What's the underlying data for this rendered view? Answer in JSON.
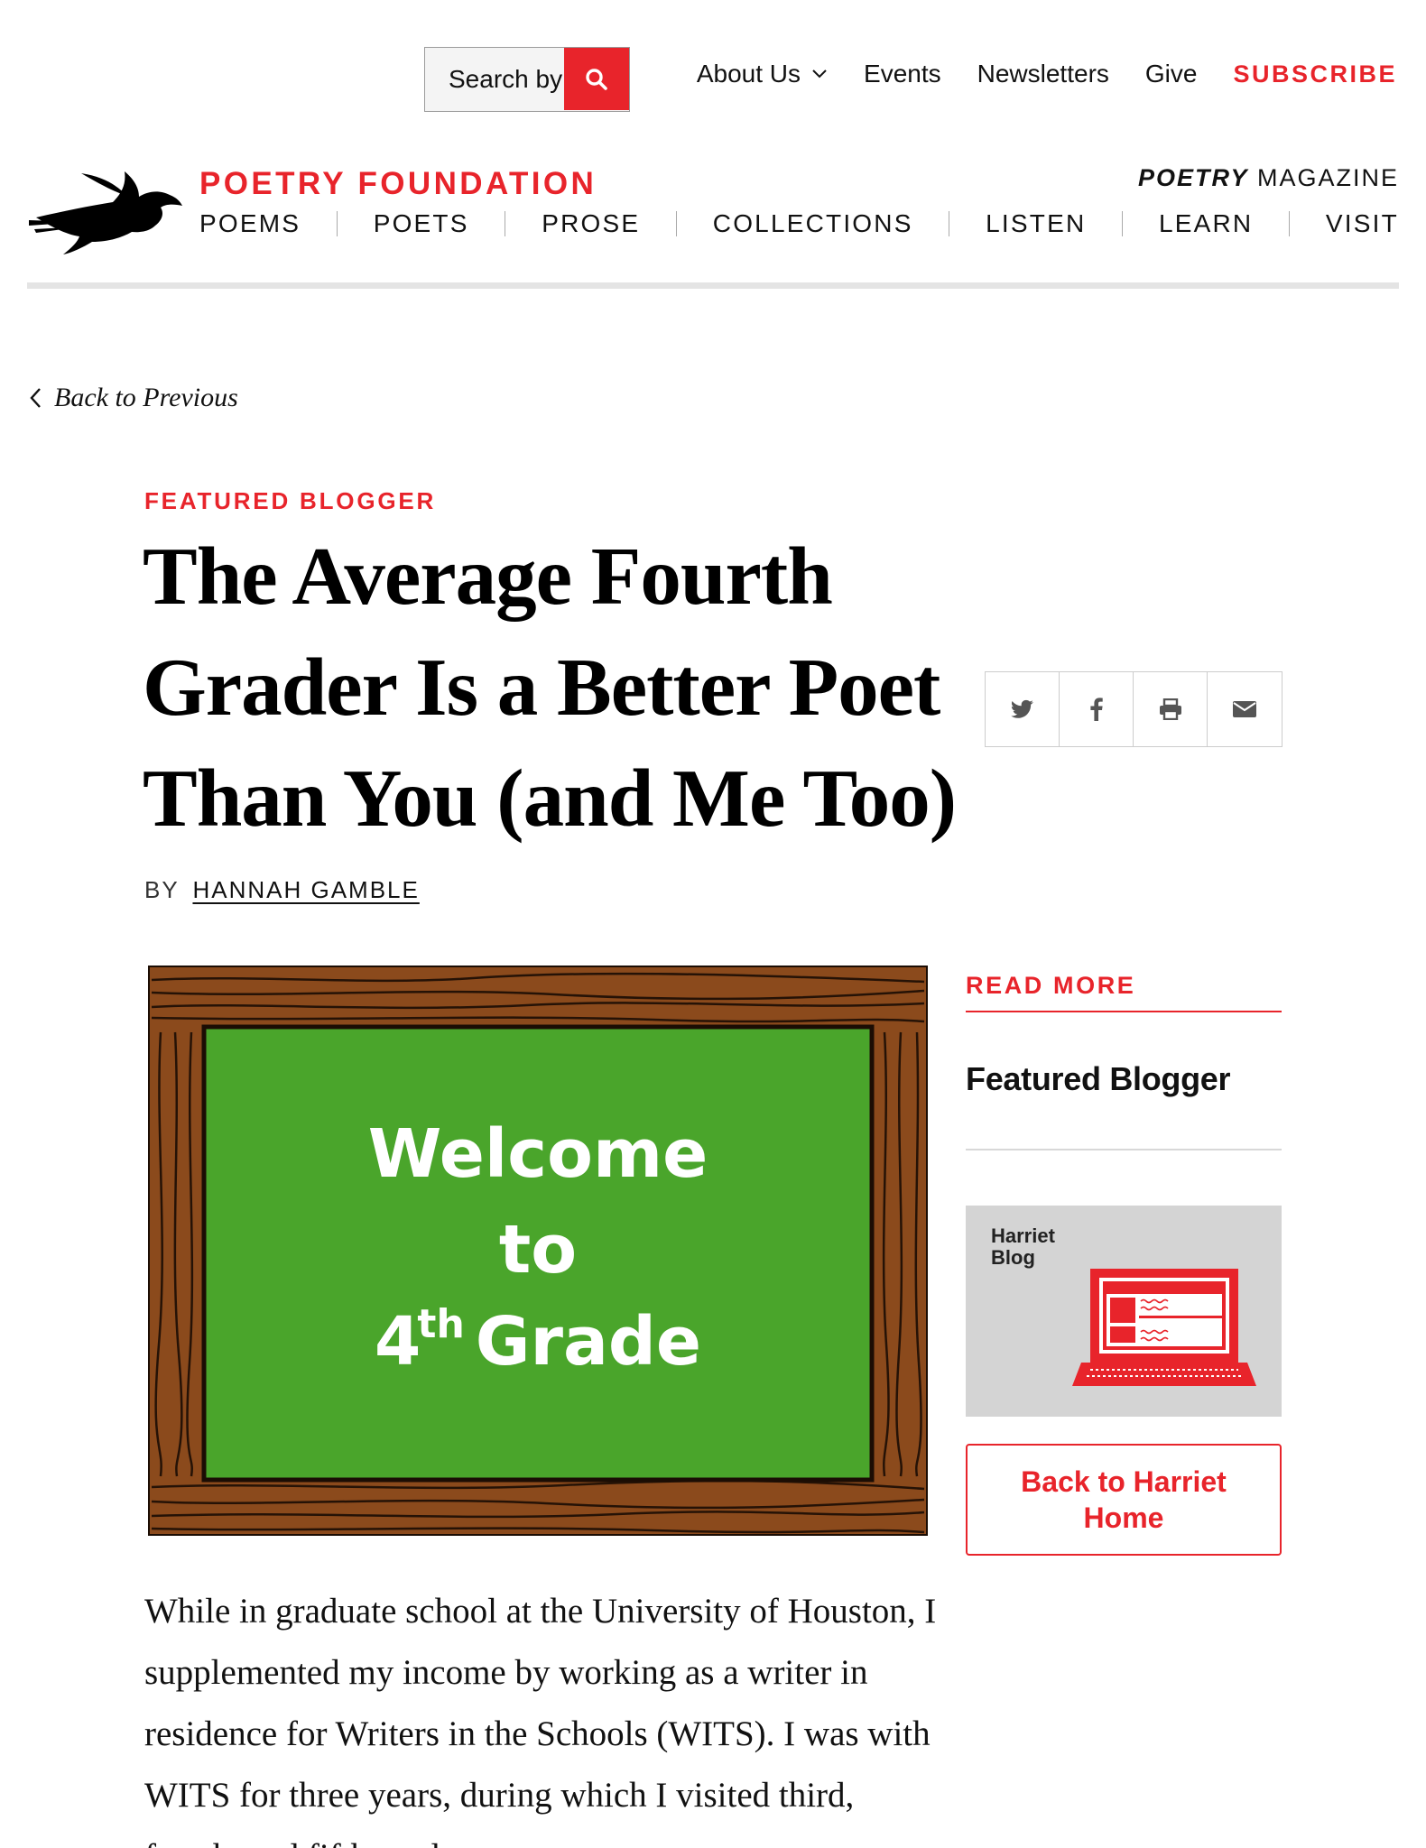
{
  "utility": {
    "search_placeholder": "Search by",
    "about_label": "About Us",
    "events_label": "Events",
    "newsletters_label": "Newsletters",
    "give_label": "Give",
    "subscribe_label": "SUBSCRIBE"
  },
  "masthead": {
    "brand": "POETRY FOUNDATION",
    "magazine_bold": "POETRY",
    "magazine_rest": " MAGAZINE"
  },
  "nav": {
    "items": [
      "POEMS",
      "POETS",
      "PROSE",
      "COLLECTIONS",
      "LISTEN",
      "LEARN",
      "VISIT"
    ]
  },
  "back_link": "Back to Previous",
  "article": {
    "kicker": "FEATURED BLOGGER",
    "title": "The Average Fourth Grader Is a Better Poet Than You (and Me Too)",
    "byline_prefix": "BY",
    "author": "HANNAH GAMBLE",
    "hero": {
      "line1": "Welcome",
      "line2": "to",
      "line3_num": "4",
      "line3_sup": "th",
      "line3_word": "Grade"
    },
    "body": "While in graduate school at the University of Houston, I supplemented my income by working as a writer in residence for Writers in the Schools (WITS). I was with WITS for three years, during which I visited third, fourth, and fifth grade"
  },
  "sidebar": {
    "read_more_label": "READ MORE",
    "featured_title": "Featured Blogger",
    "harriet_label": "Harriet Blog",
    "back_button_label": "Back to Harriet Home"
  },
  "colors": {
    "accent": "#e8242b",
    "chalkboard": "#4aa52b",
    "wood": "#8b4a1c"
  },
  "icons": {
    "share": [
      "twitter-icon",
      "facebook-icon",
      "print-icon",
      "email-icon"
    ]
  }
}
